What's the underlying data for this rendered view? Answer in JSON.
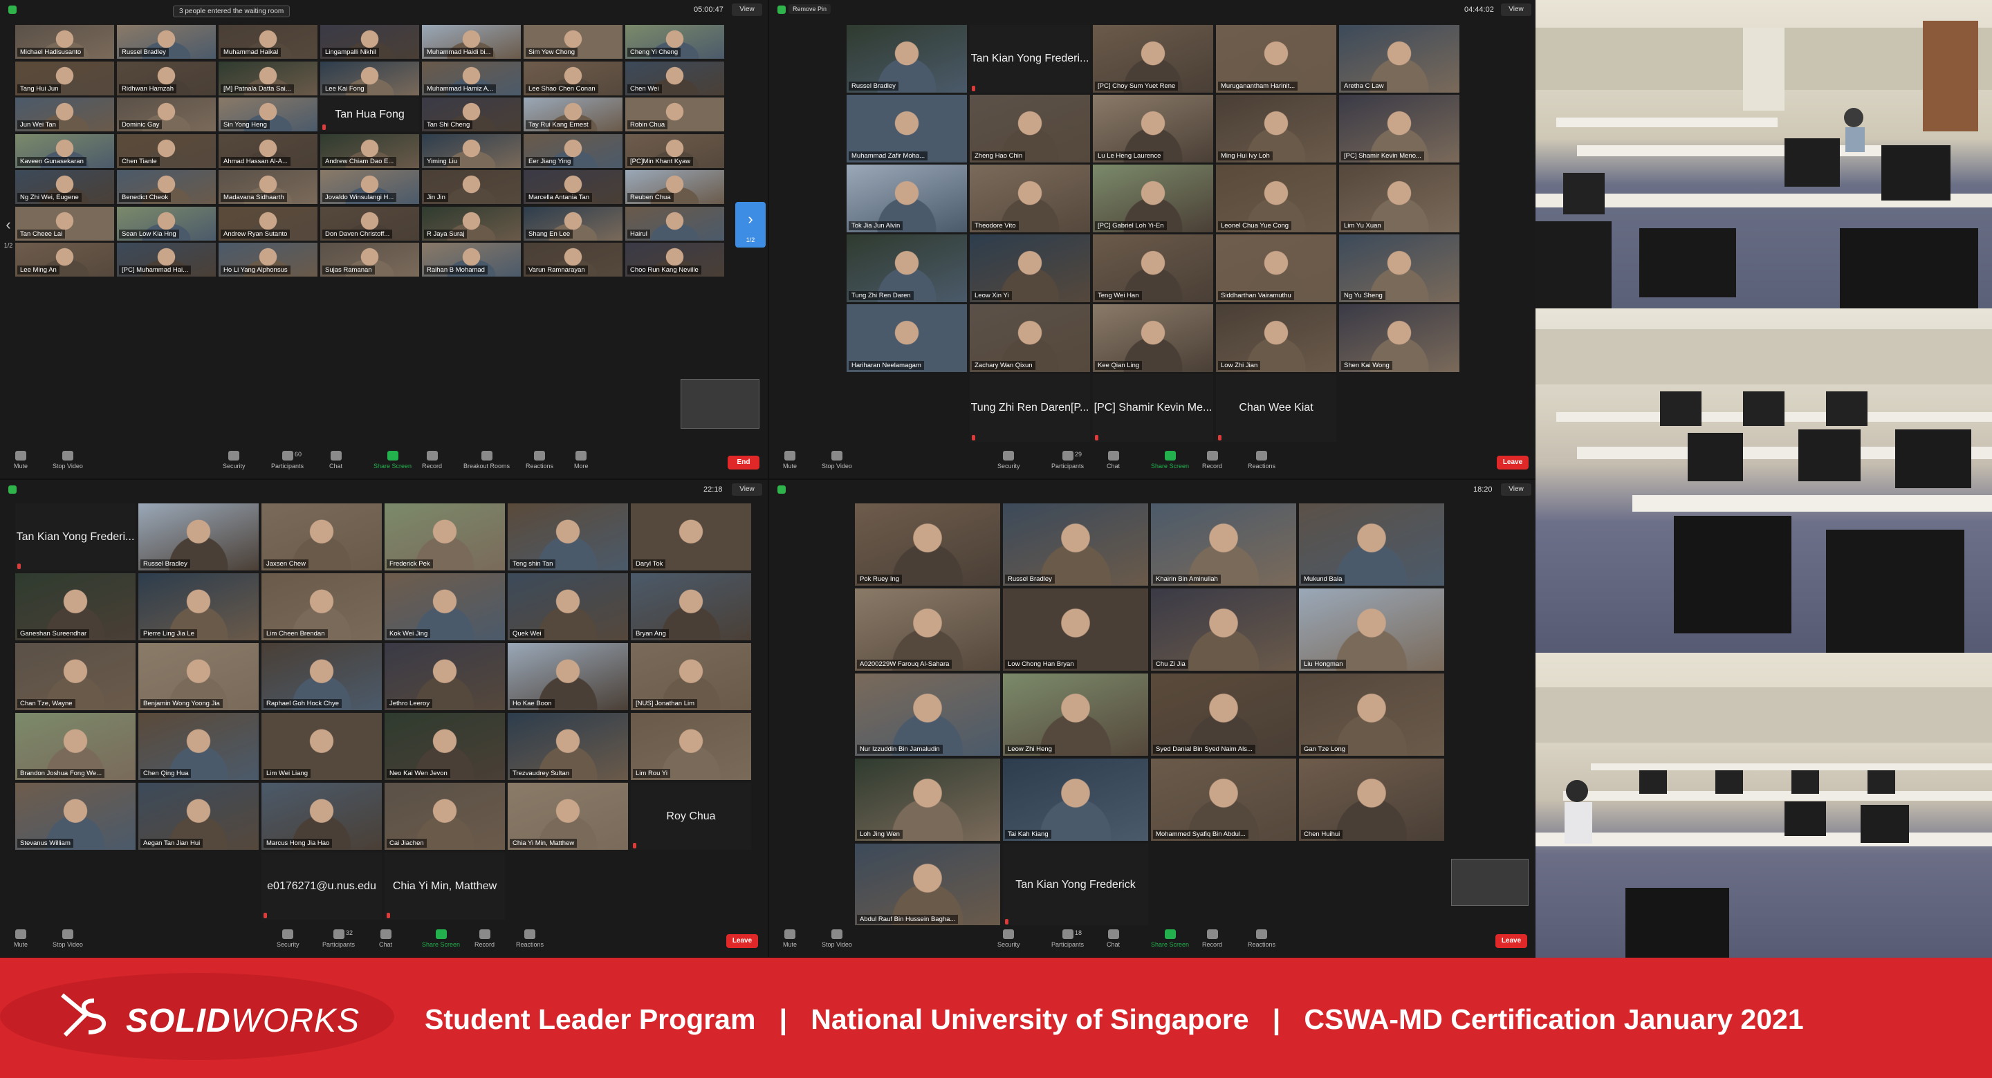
{
  "meeting1": {
    "waiting_room_notice": "3 people entered the waiting room",
    "timer": "05:00:47",
    "view_label": "View",
    "page_indicator": "1/2",
    "page_indicator_right": "1/2",
    "participants": [
      "Michael Hadisusanto",
      "Russel Bradley",
      "Muhammad Haikal",
      "Lingampalli Nikhil",
      "Muhammad Haidi bi...",
      "Sim Yew Chong",
      "Cheng Yi Cheng",
      "Tang Hui Jun",
      "Ridhwan Hamzah",
      "[M] Patnala Datta Sai...",
      "Lee Kai Fong",
      "Muhammad Hamiz A...",
      "Lee Shao Chen Conan",
      "Chen Wei",
      "Jun Wei Tan",
      "Dominic Gay",
      "Sin Yong Heng",
      "Tan Hua Fong",
      "Tan Shi Cheng",
      "Tay Rui Kang Ernest",
      "Robin Chua",
      "Kaveen Gunasekaran",
      "Chen Tianle",
      "Ahmad Hassan Al-A...",
      "Andrew Chiam Dao E...",
      "Yiming Liu",
      "Eer Jiang Ying",
      "[PC]Min Khant Kyaw",
      "Ng Zhi Wei, Eugene",
      "Benedict Cheok",
      "Madavana Sidhaarth",
      "Jovaldo Winsulangi H...",
      "Jin Jin",
      "Marcella Antania Tan",
      "Reuben Chua",
      "Tan Cheee Lai",
      "Sean Low Kia Hng",
      "Andrew Ryan Sutanto",
      "Don Daven Christoff...",
      "R Jaya Suraj",
      "Shang En Lee",
      "Hairul",
      "Lee Ming An",
      "[PC] Muhammad Hai...",
      "Ho Li Yang Alphonsus",
      "Sujas Ramanan",
      "Raihan B Mohamad",
      "Varun Ramnarayan",
      "Choo Run Kang Neville"
    ],
    "toolbar": [
      "Mute",
      "Stop Video",
      "Security",
      "Participants",
      "Chat",
      "Share Screen",
      "Record",
      "Breakout Rooms",
      "Reactions",
      "More"
    ],
    "participants_count": "60",
    "end_label": "End"
  },
  "meeting2": {
    "remove_pin": "Remove Pin",
    "timer": "04:44:02",
    "view_label": "View",
    "participants": [
      "Russel Bradley",
      "Tan Kian Yong Frederi...",
      "[PC] Choy Sum Yuet Rene",
      "Muruganantham Harinit...",
      "Aretha C Law",
      "Muhammad Zafir Moha...",
      "Zheng Hao Chin",
      "Lu Le Heng Laurence",
      "Ming Hui Ivy Loh",
      "[PC] Shamir Kevin Meno...",
      "Tok Jia Jun Alvin",
      "Theodore Vito",
      "[PC] Gabriel Loh Yi-En",
      "Leonel Chua Yue Cong",
      "Lim Yu Xuan",
      "Tung Zhi Ren Daren",
      "Leow Xin Yi",
      "Teng Wei Han",
      "Siddharthan Vairamuthu",
      "Ng Yu Sheng",
      "Hariharan Neelamagam",
      "Zachary Wan Qixun",
      "Kee Qian Ling",
      "Low Zhi Jian",
      "Shen Kai Wong",
      "Tung Zhi Ren Daren[P...",
      "[PC] Shamir Kevin Me...",
      "Chan Wee Kiat"
    ],
    "toolbar": [
      "Mute",
      "Stop Video",
      "Security",
      "Participants",
      "Chat",
      "Share Screen",
      "Record",
      "Reactions"
    ],
    "participants_count": "29",
    "end_label": "Leave"
  },
  "meeting3": {
    "timer": "22:18",
    "view_label": "View",
    "participants": [
      "Tan Kian Yong Frederi...",
      "Russel Bradley",
      "Jaxsen Chew",
      "Frederick Pek",
      "Teng shin Tan",
      "Daryl Tok",
      "Ganeshan Sureendhar",
      "Pierre Ling Jia Le",
      "Lim Cheen Brendan",
      "Kok Wei Jing",
      "Quek Wei",
      "Bryan Ang",
      "Chan Tze, Wayne",
      "Benjamin Wong Yoong Jia",
      "Raphael Goh Hock Chye",
      "Jethro Leeroy",
      "Ho Kae Boon",
      "[NUS] Jonathan Lim",
      "Brandon Joshua Fong We...",
      "Chen Qing Hua",
      "Lim Wei Liang",
      "Neo Kai Wen Jevon",
      "Trezvaudrey Sultan",
      "Lim Rou Yi",
      "Stevanus William",
      "Aegan Tan Jian Hui",
      "Marcus Hong Jia Hao",
      "Cai Jiachen",
      "Chia Yi Min, Matthew",
      "Roy Chua",
      "e0176271@u.nus.edu",
      "Chia Yi Min, Matthew"
    ],
    "toolbar": [
      "Mute",
      "Stop Video",
      "Security",
      "Participants",
      "Chat",
      "Share Screen",
      "Record",
      "Reactions"
    ],
    "participants_count": "32",
    "end_label": "Leave"
  },
  "meeting4": {
    "timer": "18:20",
    "view_label": "View",
    "participants": [
      "Pok Ruey Ing",
      "Russel Bradley",
      "Khairin Bin Aminullah",
      "Mukund Bala",
      "A0200229W Farouq Al-Sahara",
      "Low Chong Han Bryan",
      "Chu Zi Jia",
      "Liu Hongman",
      "Nur Izzuddin Bin Jamaludin",
      "Leow Zhi Heng",
      "Syed Danial Bin Syed Naim Als...",
      "Gan Tze Long",
      "Loh Jing Wen",
      "Tai Kah Kiang",
      "Mohammed Syafiq Bin Abdul...",
      "Chen Huihui",
      "Abdul Rauf Bin Hussein Bagha...",
      "Tan Kian Yong Frederick"
    ],
    "toolbar": [
      "Mute",
      "Stop Video",
      "Security",
      "Participants",
      "Chat",
      "Share Screen",
      "Record",
      "Reactions"
    ],
    "participants_count": "18",
    "end_label": "Leave"
  },
  "footer": {
    "logo_text_bold": "SOLID",
    "logo_text_rest": "WORKS",
    "caption": "Student Leader Program   |   National University of Singapore   |   CSWA-MD Certification January 2021",
    "background_color": "#d7262b"
  },
  "colors": {
    "active_speaker": "#c8e35a",
    "share_green": "#23b14d",
    "end_red": "#e02828",
    "pager_blue": "#3d8de4"
  }
}
